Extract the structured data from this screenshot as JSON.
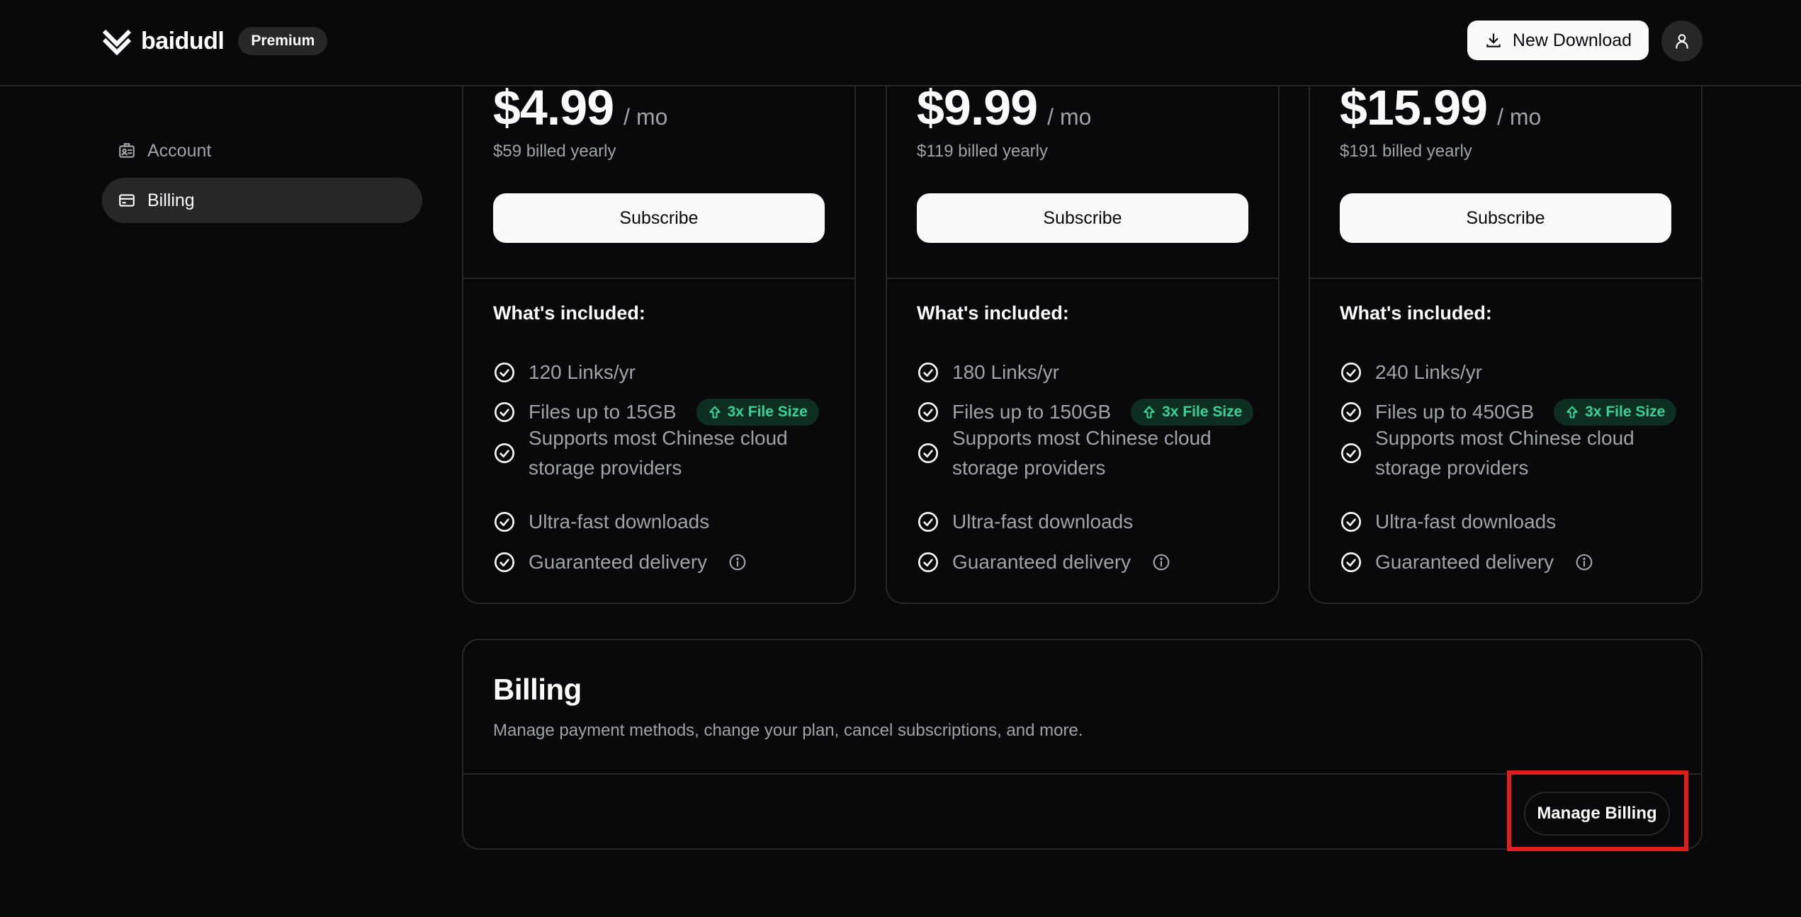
{
  "header": {
    "logo_text": "baidudl",
    "plan_badge": "Premium",
    "new_download_label": "New Download",
    "icons": {
      "logo": "baidudl-logo-icon",
      "download": "download-icon",
      "user": "user-icon"
    }
  },
  "sidebar": {
    "items": [
      {
        "label": "Account",
        "icon": "account-card-icon",
        "active": false
      },
      {
        "label": "Billing",
        "icon": "credit-card-icon",
        "active": true
      }
    ]
  },
  "plans": [
    {
      "price": "$4.99",
      "period": "/ mo",
      "billed": "$59 billed yearly",
      "subscribe_label": "Subscribe",
      "included_title": "What's included:",
      "features": {
        "links": "120 Links/yr",
        "files": "Files up to 15GB",
        "badge": "3x File Size",
        "providers": "Supports most Chinese cloud storage providers",
        "speed": "Ultra-fast downloads",
        "delivery": "Guaranteed delivery"
      }
    },
    {
      "price": "$9.99",
      "period": "/ mo",
      "billed": "$119 billed yearly",
      "subscribe_label": "Subscribe",
      "included_title": "What's included:",
      "features": {
        "links": "180 Links/yr",
        "files": "Files up to 150GB",
        "badge": "3x File Size",
        "providers": "Supports most Chinese cloud storage providers",
        "speed": "Ultra-fast downloads",
        "delivery": "Guaranteed delivery"
      }
    },
    {
      "price": "$15.99",
      "period": "/ mo",
      "billed": "$191 billed yearly",
      "subscribe_label": "Subscribe",
      "included_title": "What's included:",
      "features": {
        "links": "240 Links/yr",
        "files": "Files up to 450GB",
        "badge": "3x File Size",
        "providers": "Supports most Chinese cloud storage providers",
        "speed": "Ultra-fast downloads",
        "delivery": "Guaranteed delivery"
      }
    }
  ],
  "billing": {
    "title": "Billing",
    "description": "Manage payment methods, change your plan, cancel subscriptions, and more.",
    "manage_label": "Manage Billing"
  },
  "colors": {
    "background": "#09090b",
    "border": "#27272a",
    "muted_text": "#a1a1aa",
    "badge_green": "#34d399",
    "highlight_red": "#e11d1d"
  }
}
